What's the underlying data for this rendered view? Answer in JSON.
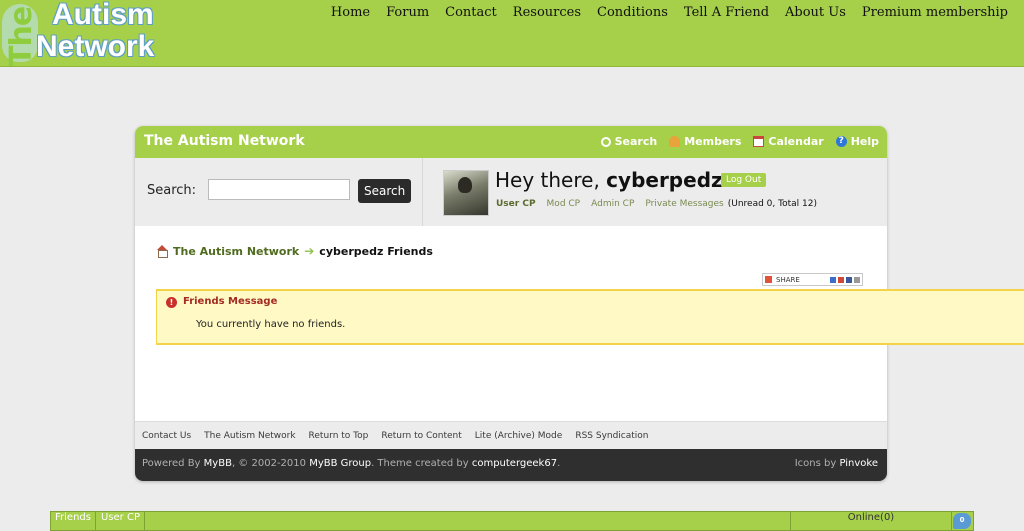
{
  "site": {
    "logo_the": "The",
    "logo_line1": "Autism",
    "logo_line2": "Network",
    "nav": [
      "Home",
      "Forum",
      "Contact",
      "Resources",
      "Conditions",
      "Tell A Friend",
      "About Us",
      "Premium membership"
    ]
  },
  "forum": {
    "title": "The Autism Network",
    "header_links": [
      {
        "label": "Search",
        "icon": "search-icon"
      },
      {
        "label": "Members",
        "icon": "members-icon"
      },
      {
        "label": "Calendar",
        "icon": "calendar-icon"
      },
      {
        "label": "Help",
        "icon": "help-icon"
      }
    ],
    "search": {
      "label": "Search:",
      "placeholder": "",
      "value": "",
      "button": "Search"
    },
    "user": {
      "greeting": "Hey there,",
      "username": "cyberpedz",
      "logout": "Log Out",
      "links": [
        "User CP",
        "Mod CP",
        "Admin CP",
        "Private Messages"
      ],
      "pm_count": "(Unread 0, Total 12)"
    },
    "breadcrumb": {
      "home": "The Autism Network",
      "arrow": "➔",
      "current": "cyberpedz Friends"
    },
    "share_label": "SHARE",
    "message": {
      "title": "Friends Message",
      "body": "You currently have no friends."
    },
    "footer_links": [
      "Contact Us",
      "The Autism Network",
      "Return to Top",
      "Return to Content",
      "Lite (Archive) Mode",
      "RSS Syndication"
    ],
    "powered": {
      "prefix": "Powered By",
      "mybb": "MyBB",
      "copy": ", © 2002-2010",
      "mybb_group": "MyBB Group",
      "theme": ". Theme created by",
      "author": "computergeek67",
      "period": ".",
      "icons_by": "Icons by",
      "icons_author": "Pinvoke"
    }
  },
  "bottombar": {
    "friends": "Friends",
    "user_cp": "User CP",
    "online": "Online(0)",
    "chat_count": "0"
  },
  "colors": {
    "accent": "#a6cf4a",
    "dark": "#2f2f2f",
    "message_bg": "#fff9c6",
    "message_border": "#f2d34a"
  }
}
